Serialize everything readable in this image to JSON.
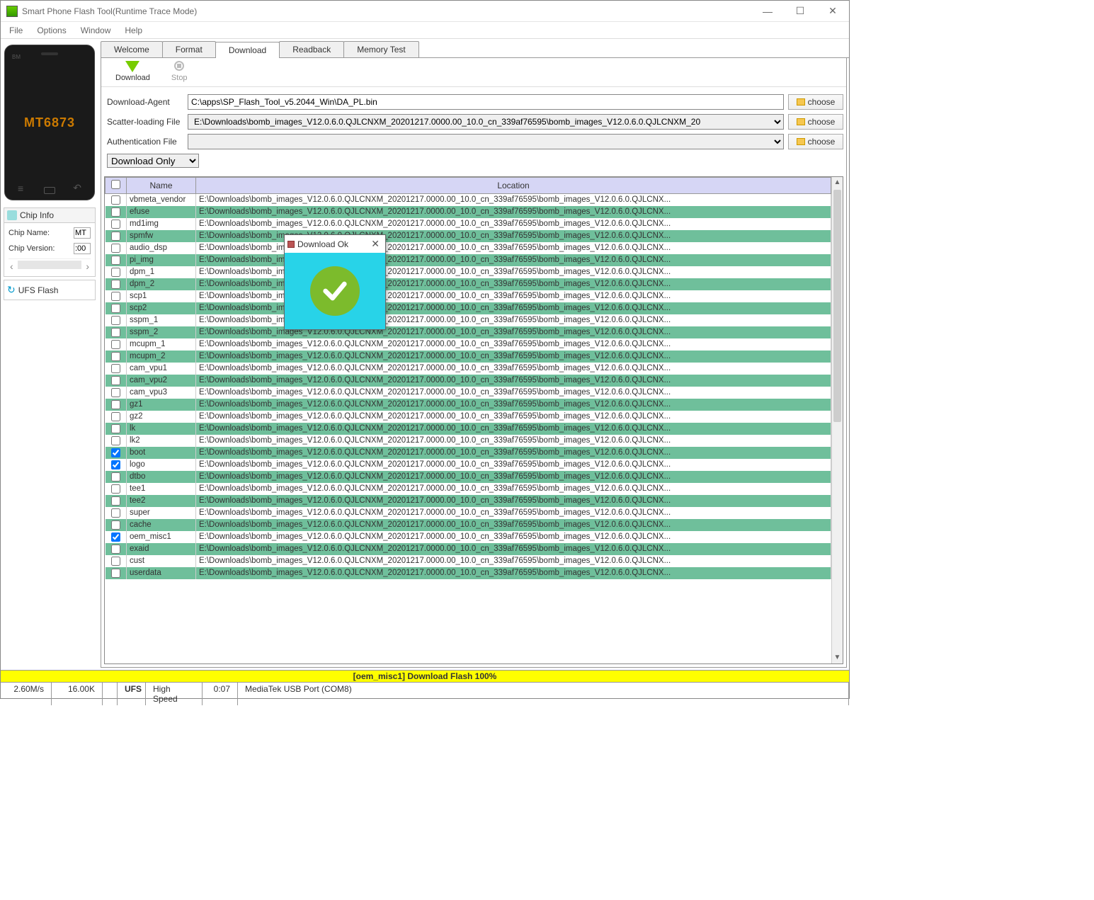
{
  "window": {
    "title": "Smart Phone Flash Tool(Runtime Trace Mode)"
  },
  "menu": {
    "file": "File",
    "options": "Options",
    "window": "Window",
    "help": "Help"
  },
  "phone": {
    "bm": "BM",
    "chip": "MT6873"
  },
  "chip_info": {
    "title": "Chip Info",
    "name_label": "Chip Name:",
    "name_value": "MT",
    "version_label": "Chip Version:",
    "version_value": ":00"
  },
  "ufs": {
    "title": "UFS Flash"
  },
  "tabs": {
    "welcome": "Welcome",
    "format": "Format",
    "download": "Download",
    "readback": "Readback",
    "memory": "Memory Test"
  },
  "toolbar": {
    "download": "Download",
    "stop": "Stop"
  },
  "form": {
    "da_label": "Download-Agent",
    "da_value": "C:\\apps\\SP_Flash_Tool_v5.2044_Win\\DA_PL.bin",
    "scatter_label": "Scatter-loading File",
    "scatter_value": "E:\\Downloads\\bomb_images_V12.0.6.0.QJLCNXM_20201217.0000.00_10.0_cn_339af76595\\bomb_images_V12.0.6.0.QJLCNXM_20",
    "auth_label": "Authentication File",
    "auth_value": "",
    "choose": "choose"
  },
  "mode_select": "Download Only",
  "columns": {
    "name": "Name",
    "location": "Location"
  },
  "location_common": "E:\\Downloads\\bomb_images_V12.0.6.0.QJLCNXM_20201217.0000.00_10.0_cn_339af76595\\bomb_images_V12.0.6.0.QJLCNX...",
  "location_short": "E:\\Downloads\\bomb_images",
  "location_mid": "217.0000.00_10.0_cn_339af76595\\bomb_images_V12.0.6.0.QJLCNX...",
  "location_partial": "E:\\Downloads\\bomb_images_V12.0.6.0.QJLCNXM_20201217.0000.00_10.0_cn_339af76595\\bomb_images_V12.0.6.0.QJLCNX...",
  "rows": [
    {
      "name": "vbmeta_vendor",
      "checked": false,
      "green": false
    },
    {
      "name": "efuse",
      "checked": false,
      "green": true
    },
    {
      "name": "md1img",
      "checked": false,
      "green": false
    },
    {
      "name": "spmfw",
      "checked": false,
      "green": true
    },
    {
      "name": "audio_dsp",
      "checked": false,
      "green": false
    },
    {
      "name": "pi_img",
      "checked": false,
      "green": true
    },
    {
      "name": "dpm_1",
      "checked": false,
      "green": false
    },
    {
      "name": "dpm_2",
      "checked": false,
      "green": true
    },
    {
      "name": "scp1",
      "checked": false,
      "green": false
    },
    {
      "name": "scp2",
      "checked": false,
      "green": true
    },
    {
      "name": "sspm_1",
      "checked": false,
      "green": false
    },
    {
      "name": "sspm_2",
      "checked": false,
      "green": true
    },
    {
      "name": "mcupm_1",
      "checked": false,
      "green": false
    },
    {
      "name": "mcupm_2",
      "checked": false,
      "green": true
    },
    {
      "name": "cam_vpu1",
      "checked": false,
      "green": false
    },
    {
      "name": "cam_vpu2",
      "checked": false,
      "green": true
    },
    {
      "name": "cam_vpu3",
      "checked": false,
      "green": false
    },
    {
      "name": "gz1",
      "checked": false,
      "green": true
    },
    {
      "name": "gz2",
      "checked": false,
      "green": false
    },
    {
      "name": "lk",
      "checked": false,
      "green": true
    },
    {
      "name": "lk2",
      "checked": false,
      "green": false
    },
    {
      "name": "boot",
      "checked": true,
      "green": true
    },
    {
      "name": "logo",
      "checked": true,
      "green": false
    },
    {
      "name": "dtbo",
      "checked": false,
      "green": true
    },
    {
      "name": "tee1",
      "checked": false,
      "green": false
    },
    {
      "name": "tee2",
      "checked": false,
      "green": true
    },
    {
      "name": "super",
      "checked": false,
      "green": false
    },
    {
      "name": "cache",
      "checked": false,
      "green": true
    },
    {
      "name": "oem_misc1",
      "checked": true,
      "green": false
    },
    {
      "name": "exaid",
      "checked": false,
      "green": true
    },
    {
      "name": "cust",
      "checked": false,
      "green": false
    },
    {
      "name": "userdata",
      "checked": false,
      "green": true
    }
  ],
  "dialog": {
    "title": "Download Ok"
  },
  "progress_text": "[oem_misc1] Download Flash 100%",
  "status": {
    "speed": "2.60M/s",
    "size": "16.00K",
    "storage": "UFS",
    "mode": "High Speed",
    "time": "0:07",
    "port": "MediaTek USB Port (COM8)"
  }
}
